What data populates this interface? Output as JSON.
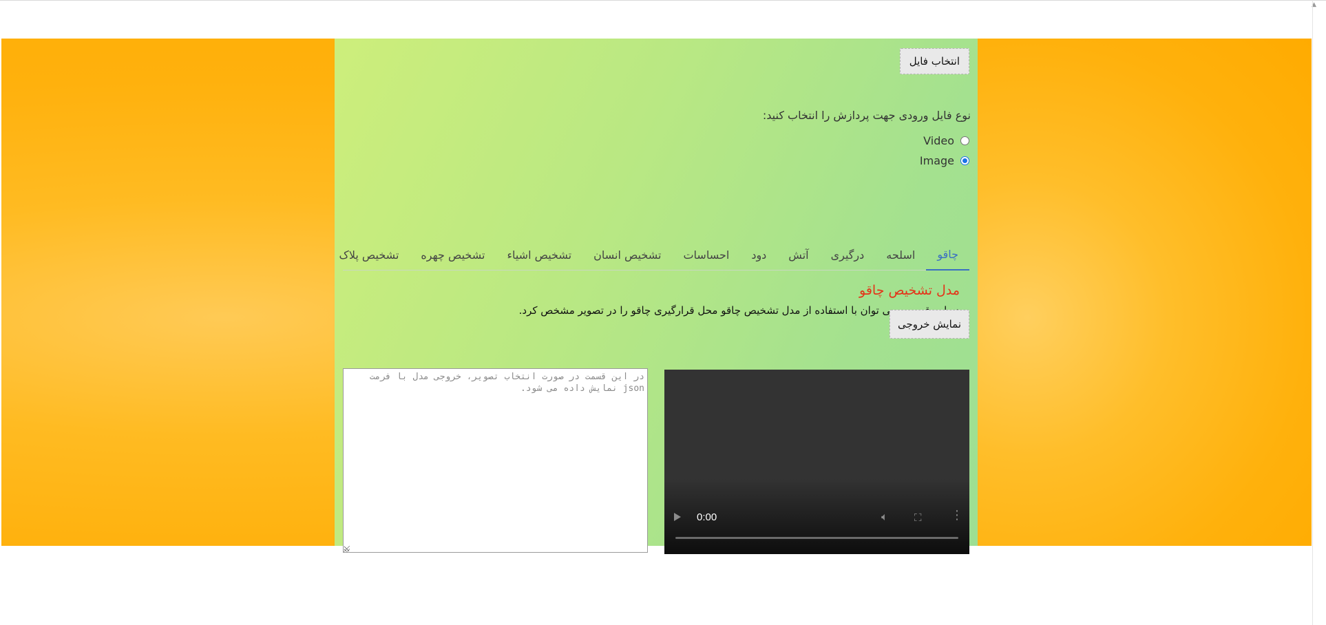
{
  "file_button": {
    "label": "انتخاب فایل"
  },
  "input_type": {
    "prompt": "نوع فایل ورودی جهت پردازش را انتخاب کنید:",
    "options": [
      {
        "label": "Video",
        "checked": false
      },
      {
        "label": "Image",
        "checked": true
      }
    ]
  },
  "tabs": [
    {
      "label": "چاقو",
      "active": true
    },
    {
      "label": "اسلحه",
      "active": false
    },
    {
      "label": "درگیری",
      "active": false
    },
    {
      "label": "آتش",
      "active": false
    },
    {
      "label": "دود",
      "active": false
    },
    {
      "label": "احساسات",
      "active": false
    },
    {
      "label": "تشخیص انسان",
      "active": false
    },
    {
      "label": "تشخیص اشیاء",
      "active": false
    },
    {
      "label": "تشخیص چهره",
      "active": false
    },
    {
      "label": "تشخیص پلاک",
      "active": false
    }
  ],
  "model": {
    "title": "مدل تشخیص چاقو",
    "description": "در این قسمت می توان با استفاده از مدل تشخیص چاقو محل قرارگیری چاقو را در تصویر مشخص کرد."
  },
  "output_button": {
    "label": "نمایش خروجی"
  },
  "json_output": {
    "placeholder": "در این قسمت در صورت انتخاب تصویر، خروجی مدل با فرمت json نمایش داده می شود."
  },
  "video_player": {
    "time": "0:00",
    "icons": [
      "play-icon",
      "volume-icon",
      "fullscreen-icon",
      "more-options-icon"
    ]
  },
  "colors": {
    "orange": "#ffb10d",
    "panel_green": "#b9e883",
    "active_tab": "#3b6fc2",
    "title_red": "#e53218"
  }
}
